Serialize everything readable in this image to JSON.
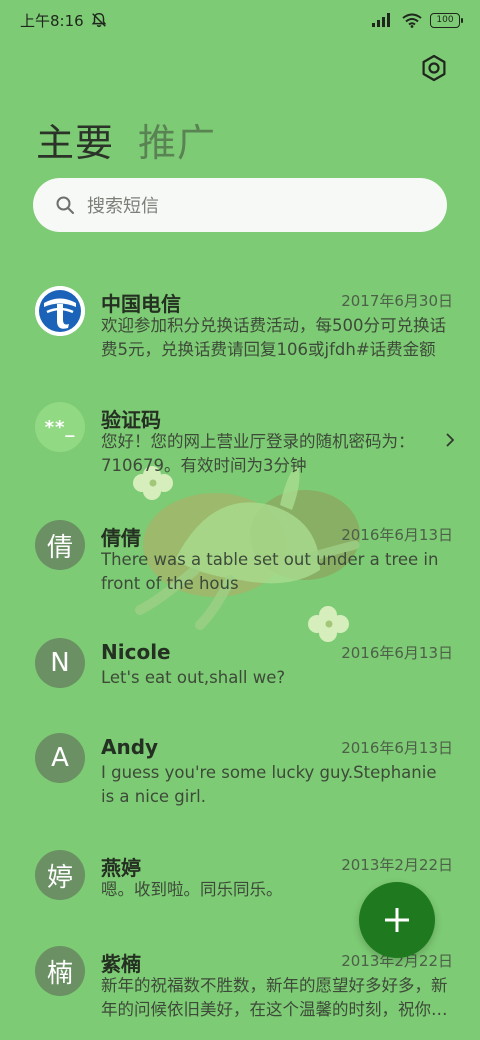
{
  "status_bar": {
    "time": "上午8:16",
    "battery": "100"
  },
  "tabs": [
    {
      "label": "主要"
    },
    {
      "label": "推广"
    }
  ],
  "search": {
    "placeholder": "搜索短信"
  },
  "conversations": [
    {
      "name": "中国电信",
      "date": "2017年6月30日",
      "preview": "欢迎参加积分兑换话费活动，每500分可兑换话费5元，兑换话费请回复106或jfdh#话费金额",
      "avatar": "telecom-logo"
    },
    {
      "name": "验证码",
      "date": "",
      "preview": "您好！您的网上营业厅登录的随机密码为：710679。有效时间为3分钟",
      "avatar_text": "**_"
    },
    {
      "name": "倩倩",
      "date": "2016年6月13日",
      "preview": "There was a table set out under a tree in front of the hous",
      "avatar_text": "倩"
    },
    {
      "name": "Nicole",
      "date": "2016年6月13日",
      "preview": "Let's eat out,shall we?",
      "avatar_text": "N"
    },
    {
      "name": "Andy",
      "date": "2016年6月13日",
      "preview": "I guess you're some lucky guy.Stephanie is a nice girl.",
      "avatar_text": "A"
    },
    {
      "name": "燕婷",
      "date": "2013年2月22日",
      "preview": "嗯。收到啦。同乐同乐。",
      "avatar_text": "婷"
    },
    {
      "name": "紫楠",
      "date": "2013年2月22日",
      "preview": "新年的祝福数不胜数，新年的愿望好多好多，新年的问候依旧美好，在这个温馨的时刻，祝你新年快乐",
      "avatar_text": "楠"
    }
  ],
  "colors": {
    "background": "#7dcb74",
    "fab": "#1f7a1f",
    "avatar": "#6a9063"
  }
}
